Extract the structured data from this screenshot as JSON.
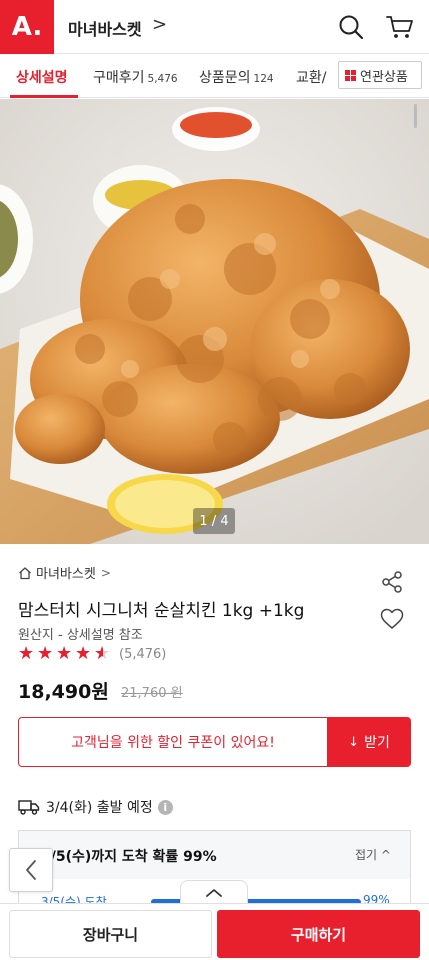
{
  "header": {
    "logo": "A.",
    "store_name": "마녀바스켓",
    "store_chevron": ">"
  },
  "tabs": [
    {
      "label": "상세설명",
      "count": ""
    },
    {
      "label": "구매후기",
      "count": "5,476"
    },
    {
      "label": "상품문의",
      "count": "124"
    },
    {
      "label": "교환/",
      "count": ""
    }
  ],
  "related_button": {
    "label": "연관상품"
  },
  "gallery": {
    "counter": "1 / 4"
  },
  "product": {
    "shop": "마녀바스켓",
    "shop_chevron": ">",
    "title": "맘스터치 시그니처 순살치킨 1kg +1kg",
    "origin": "원산지 - 상세설명 참조",
    "rating": 4.5,
    "review_count": "(5,476)",
    "price": "18,490원",
    "original_price": "21,760 원"
  },
  "coupon": {
    "message": "고객님을 위한 할인 쿠폰이 있어요!",
    "button": "받기",
    "button_icon": "↓"
  },
  "shipping": {
    "text": "3/4(화) 출발 예정",
    "info": "i",
    "arrival_title": "3/5(수)까지 도착 확률 99%",
    "fold_label": "접기",
    "row_label": "3/5(수) 도착",
    "row_percent": "99%",
    "row_percent_value": 99
  },
  "bottom": {
    "cart_label": "장바구니",
    "buy_label": "구매하기"
  },
  "colors": {
    "brand": "#e8202e",
    "arrival_blue": "#1f6fd6"
  },
  "icons": [
    "search-icon",
    "cart-icon",
    "share-icon",
    "heart-icon",
    "truck-icon",
    "house-icon",
    "chevron-left-icon",
    "chevron-up-icon",
    "grid-icon"
  ]
}
